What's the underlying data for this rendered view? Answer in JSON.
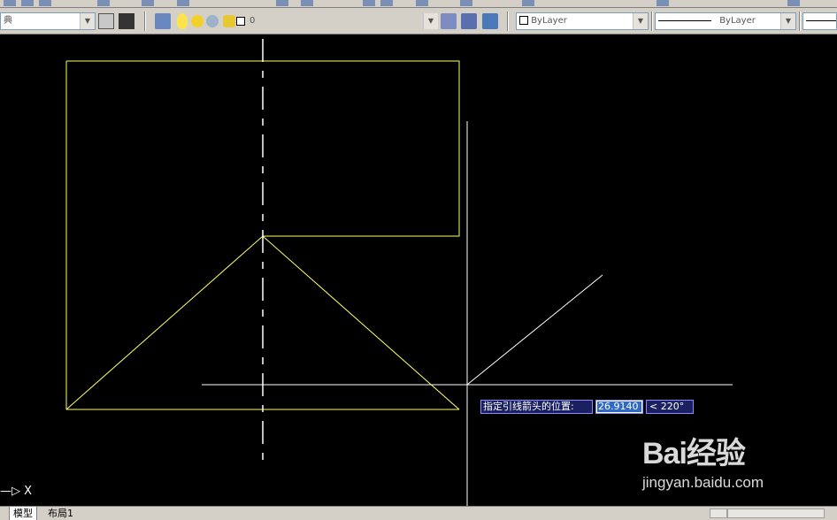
{
  "toolbar": {
    "layer_combo_value": "典",
    "layer_state_value": "0",
    "color_combo_value": "ByLayer",
    "linetype_combo_value": "ByLayer"
  },
  "dynamic_input": {
    "prompt_label": "指定引线箭头的位置:",
    "distance_value": "26.9140",
    "angle_value": "< 220°"
  },
  "ucs": {
    "axis_label": "X"
  },
  "layout_tabs": [
    {
      "label": "模型",
      "active": true
    },
    {
      "label": "布局1",
      "active": false
    }
  ],
  "watermark": {
    "logo": "Bai经验",
    "url": "jingyan.baidu.com"
  },
  "colors": {
    "canvas_bg": "#000000",
    "geometry": "#ffff66",
    "crosshair": "#ffffff",
    "centerline": "#ffffff",
    "prompt_bg": "#1a2060"
  }
}
